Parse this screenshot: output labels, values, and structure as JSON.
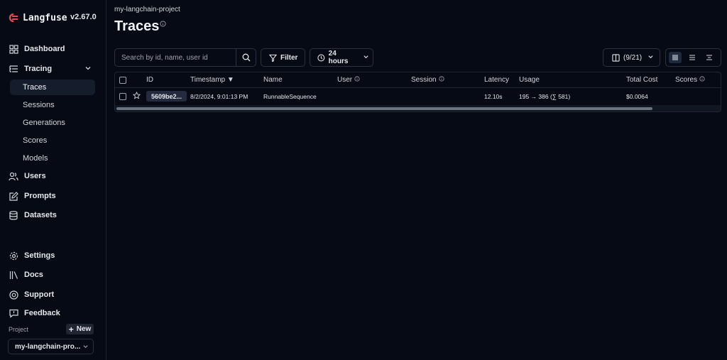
{
  "app": {
    "name": "Langfuse",
    "version": "v2.67.0"
  },
  "sidebar": {
    "items": [
      {
        "label": "Dashboard",
        "icon": "dashboard-icon"
      },
      {
        "label": "Tracing",
        "icon": "tracing-icon"
      },
      {
        "label": "Users",
        "icon": "users-icon"
      },
      {
        "label": "Prompts",
        "icon": "prompts-icon"
      },
      {
        "label": "Datasets",
        "icon": "datasets-icon"
      }
    ],
    "tracing_sub": [
      "Traces",
      "Sessions",
      "Generations",
      "Scores",
      "Models"
    ],
    "active_sub": "Traces",
    "bottom_items": [
      {
        "label": "Settings",
        "icon": "gear-icon"
      },
      {
        "label": "Docs",
        "icon": "docs-icon"
      },
      {
        "label": "Support",
        "icon": "support-icon"
      },
      {
        "label": "Feedback",
        "icon": "feedback-icon"
      }
    ],
    "project_label": "Project",
    "new_label": "New",
    "project_select": "my-langchain-pro..."
  },
  "header": {
    "breadcrumb": "my-langchain-project",
    "title": "Traces"
  },
  "toolbar": {
    "search_placeholder": "Search by id, name, user id",
    "filter_label": "Filter",
    "time_range": "24 hours",
    "columns_label": "(9/21)"
  },
  "table": {
    "columns": [
      "ID",
      "Timestamp ▼",
      "Name",
      "User",
      "Session",
      "Latency",
      "Usage",
      "Total Cost",
      "Scores"
    ],
    "rows": [
      {
        "id": "5609be2...",
        "timestamp": "8/2/2024, 9:01:13 PM",
        "name": "RunnableSequence",
        "user": "",
        "session": "",
        "latency": "12.10s",
        "usage": "195 → 386 (∑ 581)",
        "total_cost": "$0.0064",
        "scores": ""
      }
    ]
  },
  "colors": {
    "background": "#060a14",
    "border": "#2a3142",
    "accent": "#e5484d"
  }
}
